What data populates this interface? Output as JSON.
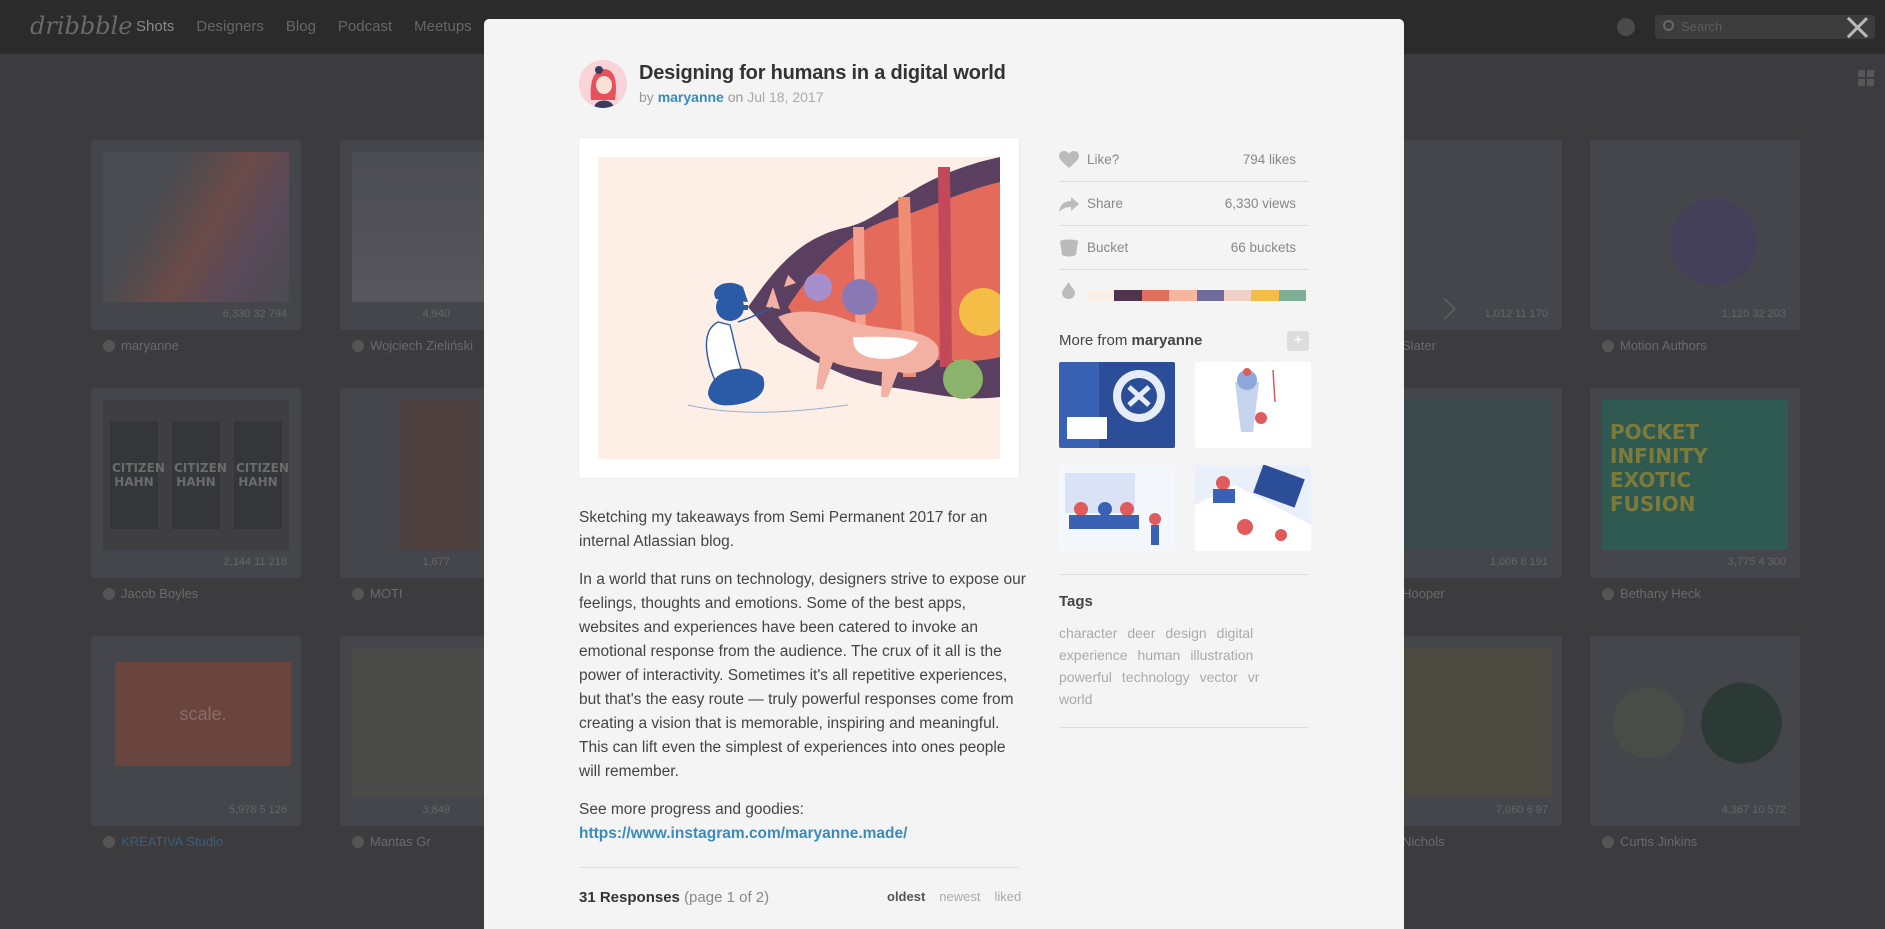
{
  "nav": {
    "logo": "dribbble",
    "items": [
      "Shots",
      "Designers",
      "Blog",
      "Podcast",
      "Meetups"
    ],
    "search_placeholder": "Search"
  },
  "background": {
    "authors": [
      "maryanne",
      "Wojciech Zieliński",
      "Jacob Boyles",
      "MOTI",
      "KREATIVA Studio",
      "Mantas Gr",
      "Slater",
      "Motion Authors",
      "Hooper",
      "Bethany Heck",
      "Nichols",
      "Curtis Jinkins"
    ],
    "stats": [
      "6,330  32  794",
      "4,940",
      "2,144  11  218",
      "1,677",
      "5,978  5  126",
      "3,849",
      "1,012  11  170",
      "1,120  32  203",
      "1,006  8  191",
      "3,775  4  300",
      "7,060  6  97",
      "4,367  10  572"
    ],
    "tile_text": {
      "citizen": "CITIZEN HAHN",
      "pocket": "POCKET INFINITY EXOTIC FUSION",
      "scale": "scale."
    }
  },
  "shot": {
    "title": "Designing for humans in a digital world",
    "by": "by",
    "author": "maryanne",
    "on": "on",
    "date": "Jul 18, 2017",
    "description": [
      "Sketching my takeaways from Semi Permanent 2017 for an internal Atlassian blog.",
      "In a world that runs on technology, designers strive to expose our feelings, thoughts and emotions. Some of the best apps, websites and experiences have been catered to invoke an emotional response from the audience. The crux of it all is the power of interactivity. Sometimes it's all repetitive experiences, but that's the easy route — truly powerful responses come from creating a vision that is memorable, inspiring and meaningful. This can lift even the simplest of experiences into ones people will remember."
    ],
    "more_text": "See more progress and goodies:",
    "link": "https://www.instagram.com/maryanne.made/",
    "responses_count": "31 Responses",
    "responses_page": "(page 1 of 2)",
    "sorts": [
      "oldest",
      "newest",
      "liked"
    ]
  },
  "meta": {
    "like_label": "Like?",
    "likes": "794 likes",
    "share_label": "Share",
    "views": "6,330 views",
    "bucket_label": "Bucket",
    "buckets": "66 buckets",
    "palette": [
      "#fbeee6",
      "#4f334f",
      "#e26f5c",
      "#f7b59f",
      "#6f6b9a",
      "#f0cfc6",
      "#f4bd45",
      "#7fae98"
    ]
  },
  "more_from": {
    "heading_prefix": "More from",
    "author": "maryanne",
    "plus": "+"
  },
  "tags": {
    "heading": "Tags",
    "items": [
      "character",
      "deer",
      "design",
      "digital",
      "experience",
      "human",
      "illustration",
      "powerful",
      "technology",
      "vector",
      "vr",
      "world"
    ]
  }
}
